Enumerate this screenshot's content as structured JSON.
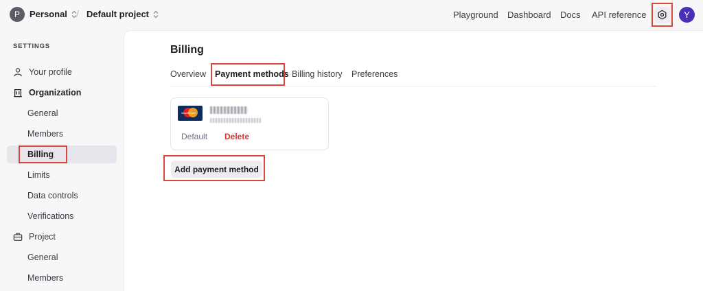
{
  "topbar": {
    "org_initial": "P",
    "org_name": "Personal",
    "separator": "/",
    "project_name": "Default project",
    "nav": [
      "Playground",
      "Dashboard",
      "Docs",
      "API reference"
    ],
    "user_initial": "Y"
  },
  "sidebar": {
    "heading": "SETTINGS",
    "items": [
      {
        "label": "Your profile",
        "icon": "person-icon"
      },
      {
        "label": "Organization",
        "icon": "building-icon"
      },
      {
        "label": "General"
      },
      {
        "label": "Members"
      },
      {
        "label": "Billing"
      },
      {
        "label": "Limits"
      },
      {
        "label": "Data controls"
      },
      {
        "label": "Verifications"
      },
      {
        "label": "Project",
        "icon": "briefcase-icon"
      },
      {
        "label": "General"
      },
      {
        "label": "Members"
      }
    ]
  },
  "main": {
    "title": "Billing",
    "tabs": [
      "Overview",
      "Payment methods",
      "Billing history",
      "Preferences"
    ],
    "active_tab": "Payment methods",
    "card": {
      "brand": "MasterCard",
      "default_label": "Default",
      "delete_label": "Delete"
    },
    "add_button": "Add payment method"
  },
  "colors": {
    "highlight": "#d9463b",
    "avatar": "#4a2fb8",
    "delete": "#e5322d"
  }
}
